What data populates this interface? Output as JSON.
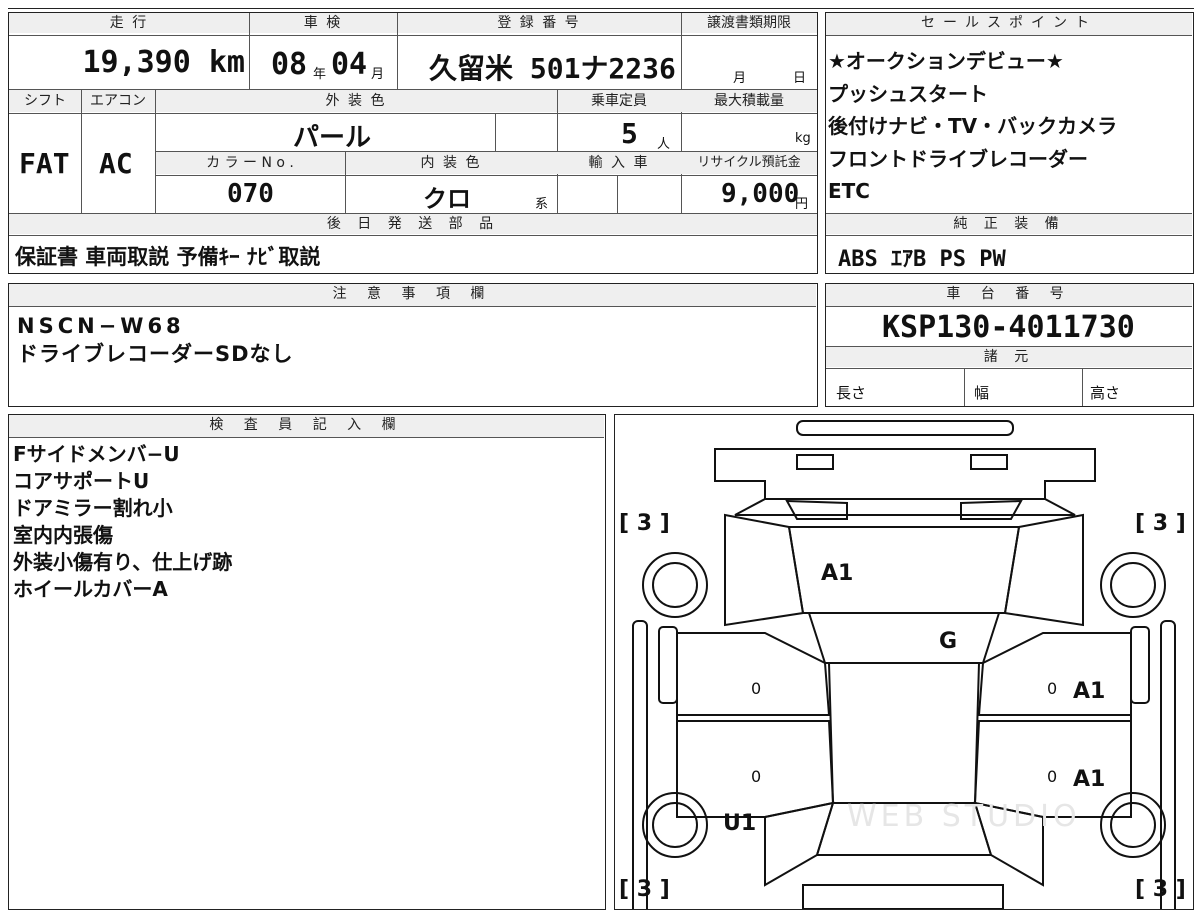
{
  "top_info": {
    "labels": {
      "mileage": "走 行",
      "inspection": "車 検",
      "registration": "登 録 番 号",
      "transfer_deadline": "譲渡書類期限",
      "shift": "シフト",
      "aircon": "エアコン",
      "exterior_color": "外 装 色",
      "capacity": "乗車定員",
      "max_load": "最大積載量",
      "color_no": "カ ラ ー N o .",
      "interior_color": "内 装 色",
      "import": "輸 入 車",
      "recycle": "リサイクル預託金",
      "later_parts": "後 日 発 送 部 品"
    },
    "mileage": "19,390 km",
    "inspection_year": "08",
    "inspection_year_unit": "年",
    "inspection_month": "04",
    "inspection_month_unit": "月",
    "registration": "久留米 501ナ2236",
    "deadline_month_unit": "月",
    "deadline_day_unit": "日",
    "shift": "FAT",
    "aircon": "AC",
    "exterior_color": "パール",
    "capacity": "5",
    "capacity_unit": "人",
    "max_load_unit": "kg",
    "color_no": "070",
    "interior_color": "クロ",
    "interior_color_suffix": "系",
    "recycle": "9,000",
    "recycle_unit": "円",
    "later_parts": "保証書 車両取説 予備ｷｰ ﾅﾋﾞ取説"
  },
  "sales_points": {
    "header": "セールスポイント",
    "lines": [
      "★オークションデビュー★",
      "プッシュスタート",
      "後付けナビ・TV・バックカメラ",
      "フロントドライブレコーダー",
      "ETC"
    ]
  },
  "genuine_equipment": {
    "header": "純 正 装 備",
    "value": "ABS ｴｱB PS PW"
  },
  "notes": {
    "header": "注 意 事 項 欄",
    "lines": [
      "NSCN−W68",
      "ドライブレコーダーSDなし"
    ]
  },
  "chassis": {
    "header": "車 台 番 号",
    "value": "KSP130-4011730"
  },
  "specs": {
    "header": "諸 元",
    "length": "長さ",
    "width": "幅",
    "height": "高さ"
  },
  "inspector": {
    "header": "検 査 員 記 入 欄",
    "lines": [
      "Fサイドメンバ−U",
      "コアサポートU",
      "ドアミラー割れ小",
      "室内内張傷",
      "外装小傷有り、仕上げ跡",
      "ホイールカバーA"
    ]
  },
  "diagram": {
    "tire_tread": [
      "3",
      "3",
      "3",
      "3"
    ],
    "marks": {
      "hood": "A1",
      "windshield": "G",
      "right_front_door": "A1",
      "right_rear_door": "A1",
      "left_rear_fender": "U1"
    },
    "door_counts": [
      "0",
      "0",
      "0",
      "0"
    ],
    "watermark": "WEB STUDIO"
  }
}
